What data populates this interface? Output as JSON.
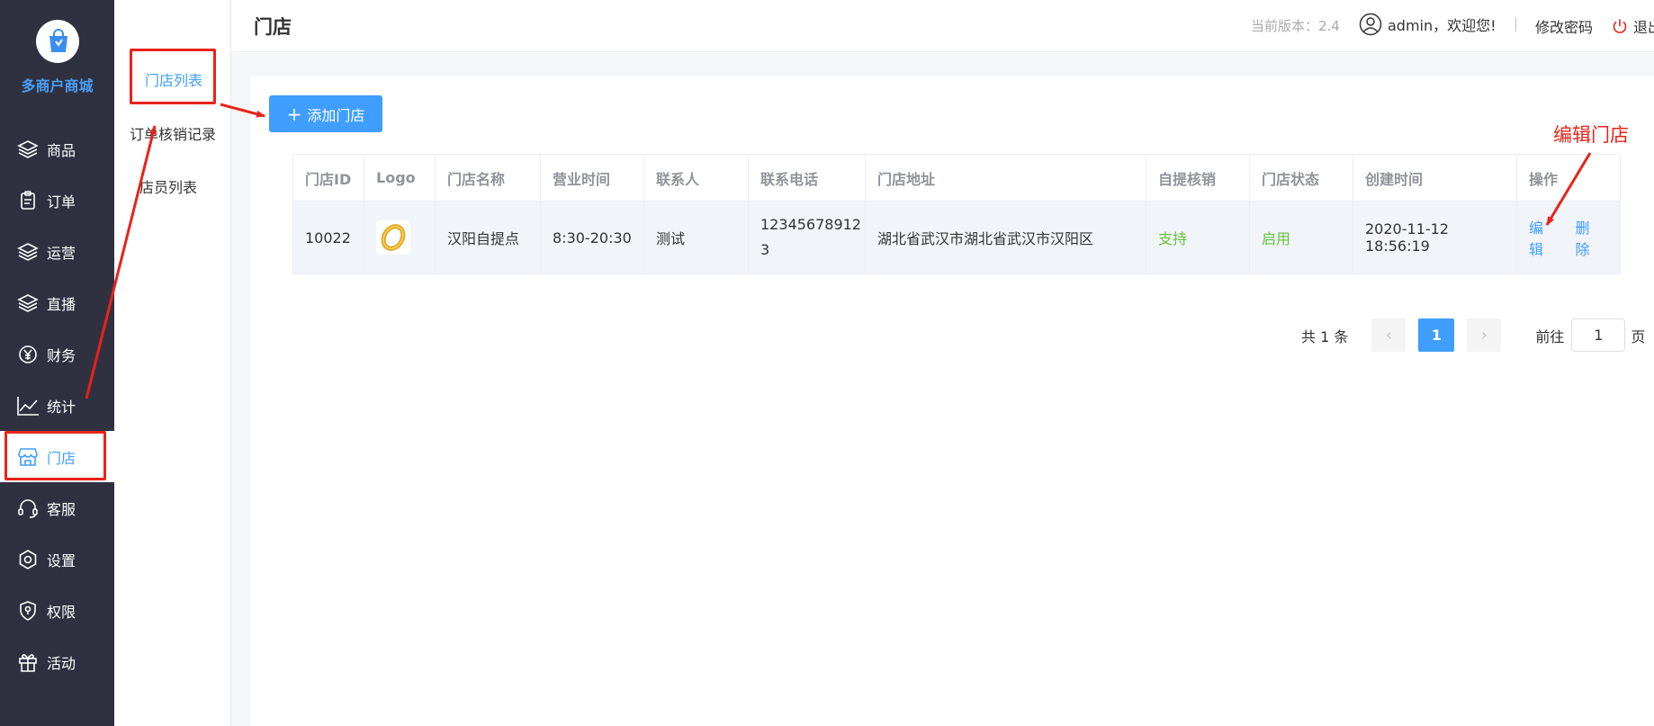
{
  "app": {
    "name": "多商户商城"
  },
  "sidebar": {
    "items": [
      {
        "label": "商品",
        "icon": "layers-icon"
      },
      {
        "label": "订单",
        "icon": "clipboard-icon"
      },
      {
        "label": "运营",
        "icon": "layers-icon"
      },
      {
        "label": "直播",
        "icon": "layers-icon"
      },
      {
        "label": "财务",
        "icon": "yen-icon"
      },
      {
        "label": "统计",
        "icon": "chart-line-icon"
      },
      {
        "label": "门店",
        "icon": "store-icon",
        "active": true
      },
      {
        "label": "客服",
        "icon": "headset-icon"
      },
      {
        "label": "设置",
        "icon": "gear-icon"
      },
      {
        "label": "权限",
        "icon": "shield-icon"
      },
      {
        "label": "活动",
        "icon": "gift-icon"
      }
    ]
  },
  "submenu": {
    "items": [
      {
        "label": "门店列表",
        "active": true
      },
      {
        "label": "订单核销记录"
      },
      {
        "label": "店员列表"
      }
    ]
  },
  "header": {
    "title": "门店",
    "version": "当前版本：2.4",
    "user": "admin，欢迎您!",
    "separator": "|",
    "change_password": "修改密码",
    "logout": "退出"
  },
  "toolbar": {
    "add_label": "添加门店"
  },
  "table": {
    "columns": [
      "门店ID",
      "Logo",
      "门店名称",
      "营业时间",
      "联系人",
      "联系电话",
      "门店地址",
      "自提核销",
      "门店状态",
      "创建时间",
      "操作"
    ],
    "rows": [
      {
        "id": "10022",
        "name": "汉阳自提点",
        "hours": "8:30-20:30",
        "contact": "测试",
        "phone_line1": "12345678912",
        "phone_line2": "3",
        "address": "湖北省武汉市湖北省武汉市汉阳区",
        "self_pickup": "支持",
        "status": "启用",
        "created": "2020-11-12 18:56:19",
        "edit": "编辑",
        "delete": "删除"
      }
    ]
  },
  "pagination": {
    "total": "共 1 条",
    "current": "1",
    "goto_label": "前往",
    "goto_value": "1",
    "unit": "页"
  },
  "annotation": {
    "text": "编辑门店",
    "color": "#e8231b"
  },
  "colors": {
    "primary": "#409eff",
    "sidebar_bg": "#2f3141",
    "success": "#67c23a"
  }
}
